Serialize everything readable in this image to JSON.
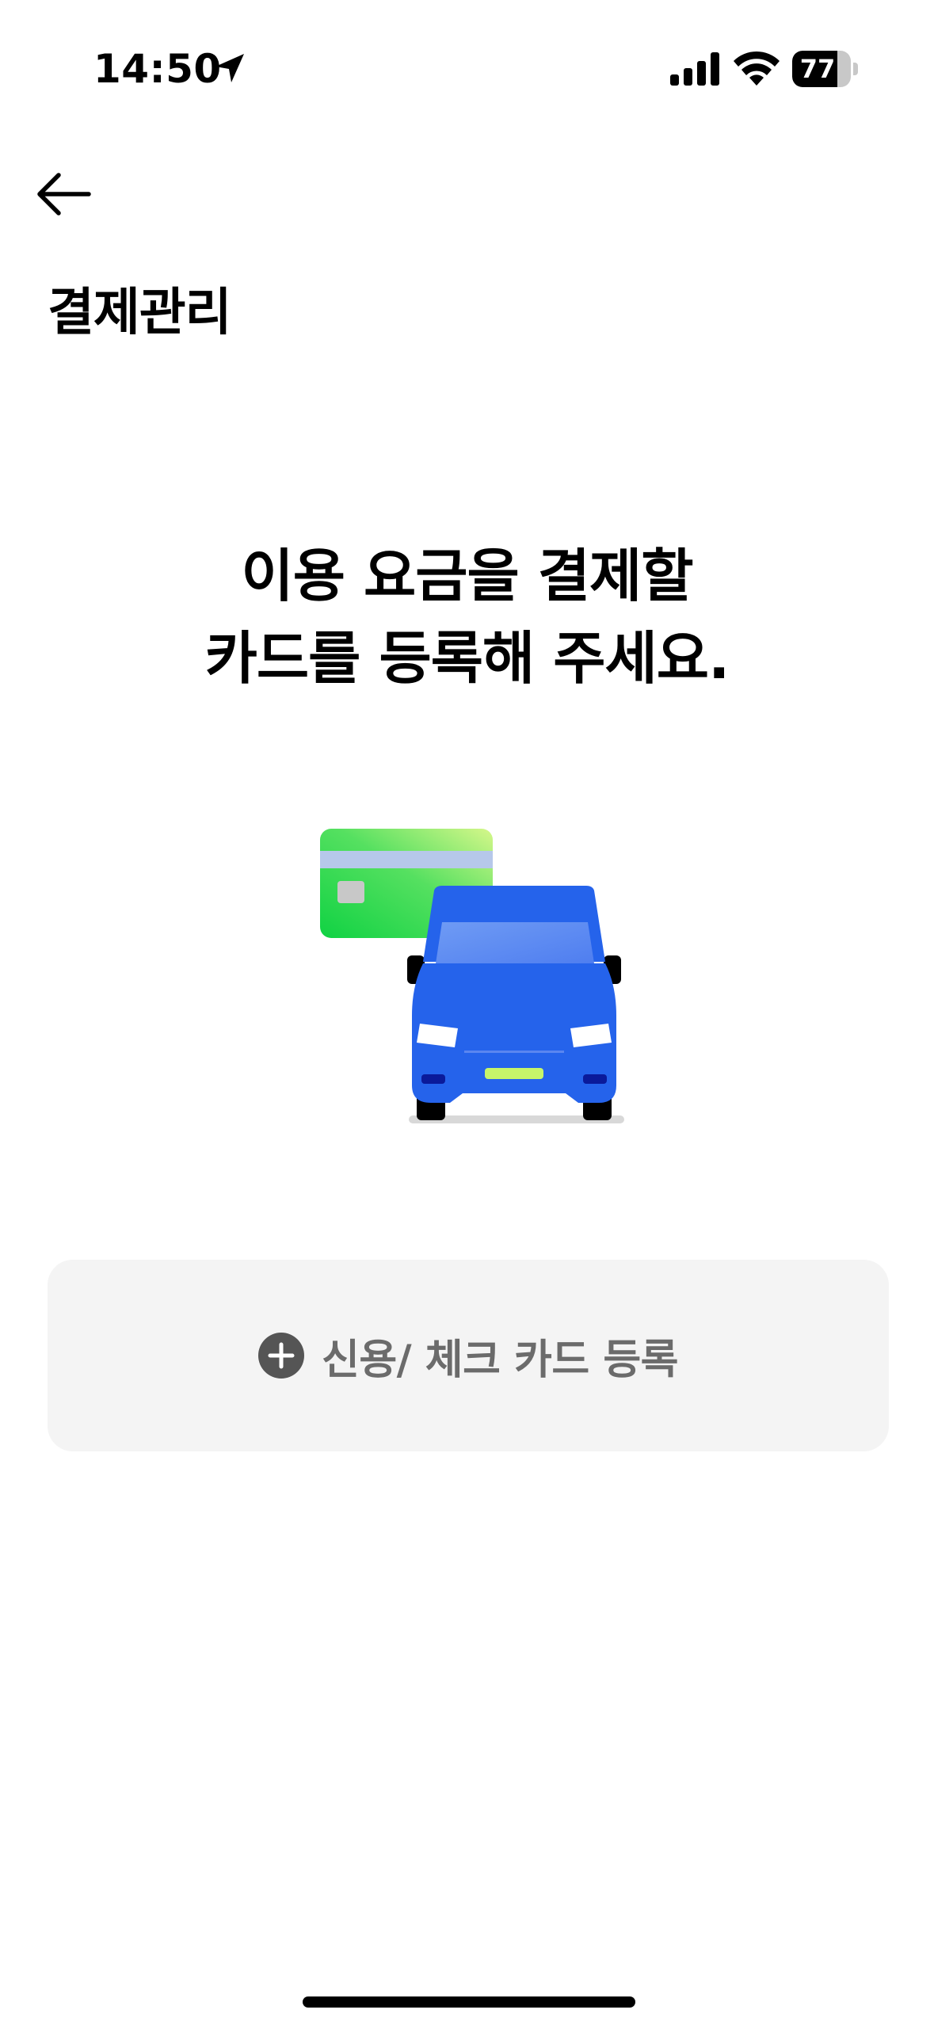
{
  "status_bar": {
    "time": "14:50",
    "battery_level": "77",
    "battery_fraction": 0.77,
    "icons": [
      "location-arrow-icon",
      "cellular-signal-icon",
      "wifi-icon",
      "battery-icon"
    ]
  },
  "header": {
    "back_icon": "arrow-left-icon",
    "title": "결제관리"
  },
  "main": {
    "headline_line1": "이용 요금을 결제할",
    "headline_line2": "카드를 등록해 주세요.",
    "illustration": "credit-card-and-blue-truck-illustration",
    "register_button": {
      "icon": "plus-circle-icon",
      "label": "신용/ 체크 카드 등록"
    }
  },
  "colors": {
    "accent_blue": "#2563eb",
    "card_green": "#22d04b",
    "button_background": "#f4f4f4",
    "button_text": "#6b6b6b"
  }
}
